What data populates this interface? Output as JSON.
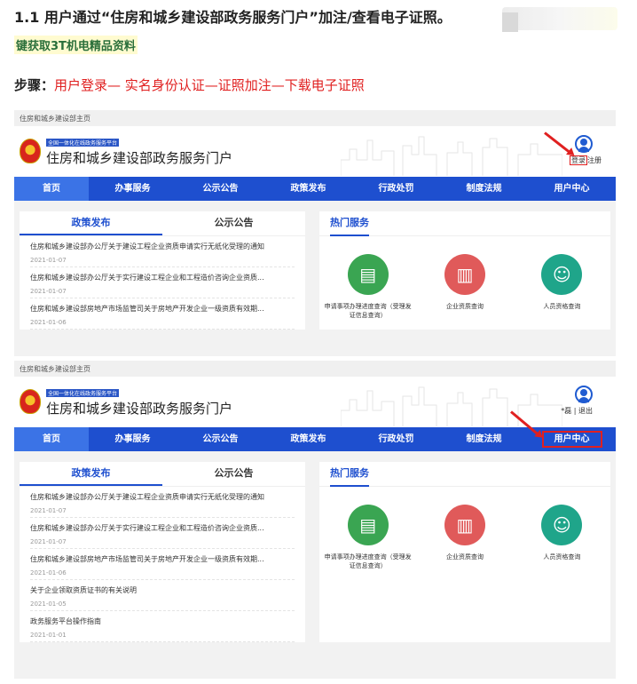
{
  "article": {
    "title": "1.1 用户通过“住房和城乡建设部政务服务门户”加注/查看电子证照。",
    "promo_link": "键获取3T机电精品资料",
    "steps_label": "步骤：",
    "steps_value": "用户登录— 实名身份认证—证照加注—下载电子证照"
  },
  "portal": {
    "breadcrumb": "住房和城乡建设部主页",
    "tag": "全国一体化在线政务服务平台",
    "name": "住房和城乡建设部政务服务门户",
    "login": "登录",
    "register": "注册",
    "logged_in_links": "*磊 | 退出",
    "nav": [
      "首页",
      "办事服务",
      "公示公告",
      "政策发布",
      "行政处罚",
      "制度法规",
      "用户中心"
    ],
    "tabs": [
      "政策发布",
      "公示公告"
    ],
    "hot_title": "热门服务",
    "news": [
      {
        "title": "住房和城乡建设部办公厅关于建设工程企业资质申请实行无纸化受理的通知",
        "date": "2021-01-07"
      },
      {
        "title": "住房和城乡建设部办公厅关于实行建设工程企业和工程造价咨询企业资质...",
        "date": "2021-01-07"
      },
      {
        "title": "住房和城乡建设部房地产市场监管司关于房地产开发企业一级资质有效期...",
        "date": "2021-01-06"
      },
      {
        "title": "关于企业领取资质证书的有关说明",
        "date": "2021-01-05"
      },
      {
        "title": "政务服务平台操作指南",
        "date": "2021-01-01"
      }
    ],
    "services": [
      {
        "label": "申请事项办理进度查询（受理发证信息查询）",
        "color": "#3aa552",
        "icon": "document-icon"
      },
      {
        "label": "企业资质查询",
        "color": "#e05a5a",
        "icon": "building-icon"
      },
      {
        "label": "人员资格查询",
        "color": "#1fa58a",
        "icon": "worker-icon"
      }
    ]
  }
}
